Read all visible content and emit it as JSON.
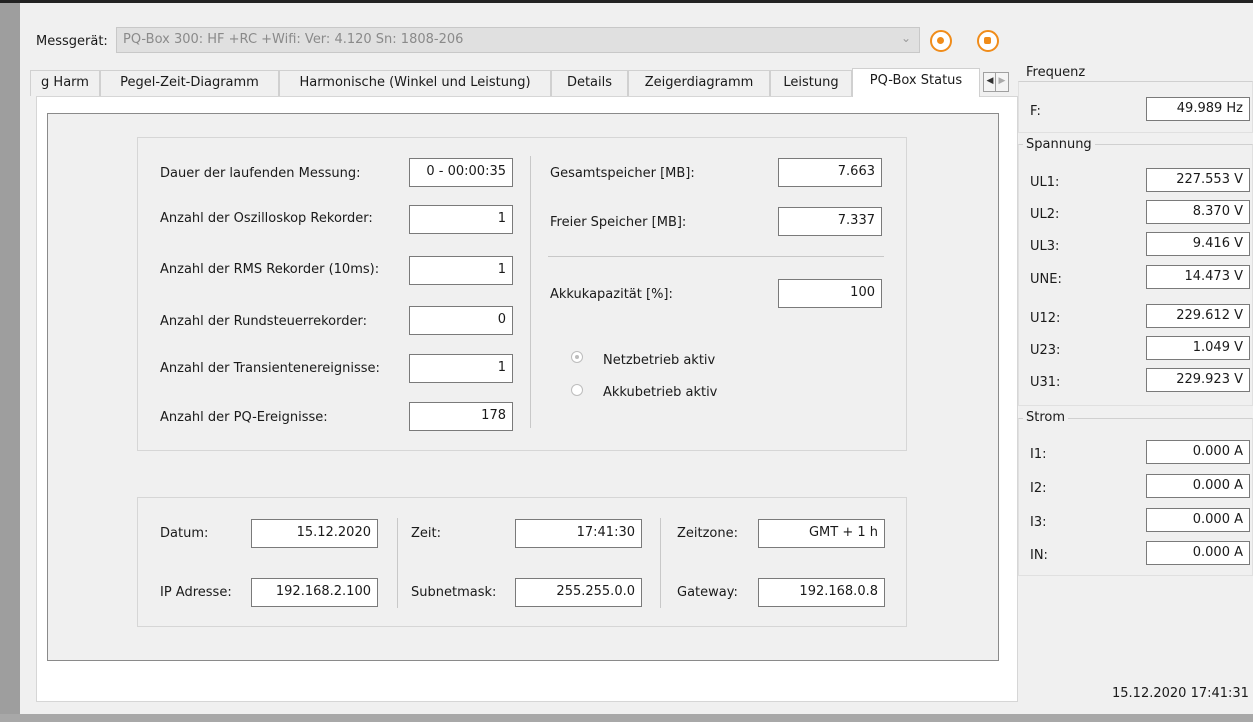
{
  "device": {
    "label": "Messgerät:",
    "value": "PQ-Box 300: HF +RC +Wifi: Ver: 4.120 Sn: 1808-206"
  },
  "tabs": [
    {
      "label": "g Harm",
      "active": false
    },
    {
      "label": "Pegel-Zeit-Diagramm",
      "active": false
    },
    {
      "label": "Harmonische (Winkel und Leistung)",
      "active": false
    },
    {
      "label": "Details",
      "active": false
    },
    {
      "label": "Zeigerdiagramm",
      "active": false
    },
    {
      "label": "Leistung",
      "active": false
    },
    {
      "label": "PQ-Box Status",
      "active": true
    }
  ],
  "tab_scroll": {
    "left": "◀",
    "right": "▶"
  },
  "status_left": [
    {
      "label": "Dauer der laufenden Messung:",
      "value": "0 - 00:00:35"
    },
    {
      "label": "Anzahl der Oszilloskop Rekorder:",
      "value": "1"
    },
    {
      "label": "Anzahl der RMS Rekorder (10ms):",
      "value": "1"
    },
    {
      "label": "Anzahl der Rundsteuerrekorder:",
      "value": "0"
    },
    {
      "label": "Anzahl der Transientenereignisse:",
      "value": "1"
    },
    {
      "label": "Anzahl der PQ-Ereignisse:",
      "value": "178"
    }
  ],
  "status_right": [
    {
      "label": "Gesamtspeicher [MB]:",
      "value": "7.663"
    },
    {
      "label": "Freier Speicher [MB]:",
      "value": "7.337"
    },
    {
      "label": "Akkukapazität [%]:",
      "value": "100"
    }
  ],
  "power_mode": [
    {
      "label": "Netzbetrieb aktiv",
      "selected": true
    },
    {
      "label": "Akkubetrieb aktiv",
      "selected": false
    }
  ],
  "network": {
    "date": {
      "label": "Datum:",
      "value": "15.12.2020"
    },
    "time": {
      "label": "Zeit:",
      "value": "17:41:30"
    },
    "timezone": {
      "label": "Zeitzone:",
      "value": "GMT + 1 h"
    },
    "ip": {
      "label": "IP Adresse:",
      "value": "192.168.2.100"
    },
    "subnet": {
      "label": "Subnetmask:",
      "value": "255.255.0.0"
    },
    "gateway": {
      "label": "Gateway:",
      "value": "192.168.0.8"
    }
  },
  "frequency": {
    "title": "Frequenz",
    "rows": [
      {
        "label": "F:",
        "value": "49.989 Hz"
      }
    ]
  },
  "voltage": {
    "title": "Spannung",
    "rows": [
      {
        "label": "UL1:",
        "value": "227.553 V"
      },
      {
        "label": "UL2:",
        "value": "8.370 V"
      },
      {
        "label": "UL3:",
        "value": "9.416 V"
      },
      {
        "label": "UNE:",
        "value": "14.473 V"
      },
      {
        "label": "U12:",
        "value": "229.612 V"
      },
      {
        "label": "U23:",
        "value": "1.049 V"
      },
      {
        "label": "U31:",
        "value": "229.923 V"
      }
    ]
  },
  "current": {
    "title": "Strom",
    "rows": [
      {
        "label": "I1:",
        "value": "0.000 A"
      },
      {
        "label": "I2:",
        "value": "0.000 A"
      },
      {
        "label": "I3:",
        "value": "0.000 A"
      },
      {
        "label": "IN:",
        "value": "0.000 A"
      }
    ]
  },
  "status_bar": {
    "datetime": "15.12.2020 17:41:31"
  },
  "colors": {
    "accent": "#f08c1a",
    "field_border": "#7a7a7a",
    "panel_bg": "#f0f0f0"
  }
}
